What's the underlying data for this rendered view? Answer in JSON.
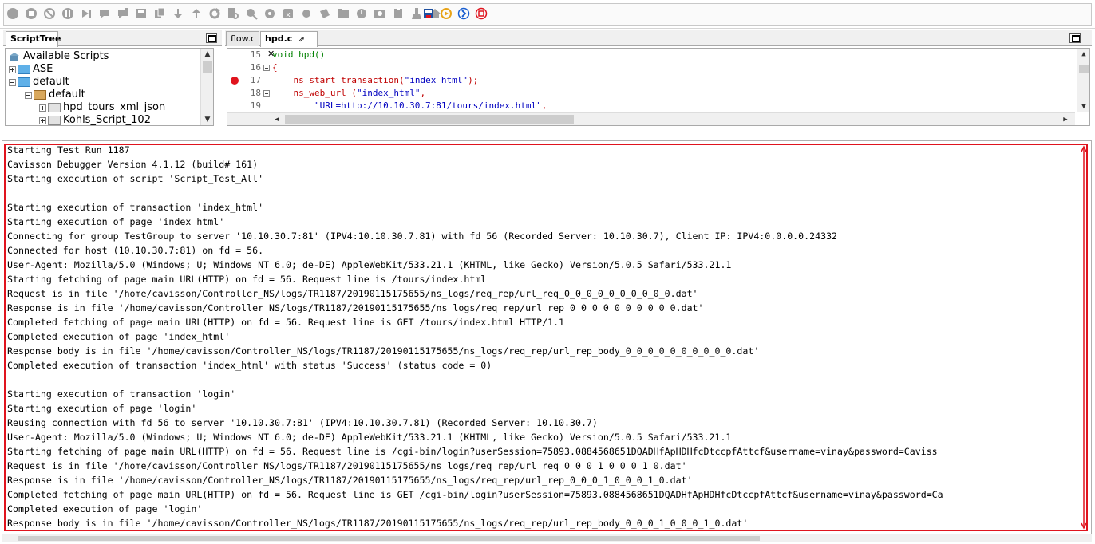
{
  "toolbar": {
    "buttons": [
      {
        "name": "start-icon",
        "color": "#a0a0a0"
      },
      {
        "name": "stop-icon",
        "color": "#a0a0a0"
      },
      {
        "name": "abort-icon",
        "color": "#a0a0a0"
      },
      {
        "name": "pause-icon",
        "color": "#a0a0a0"
      },
      {
        "name": "step-icon",
        "color": "#a0a0a0"
      },
      {
        "name": "comment-icon",
        "color": "#a0a0a0"
      },
      {
        "name": "comment-block-icon",
        "color": "#a0a0a0"
      },
      {
        "name": "save-icon",
        "color": "#a0a0a0"
      },
      {
        "name": "copy-icon",
        "color": "#a0a0a0"
      },
      {
        "name": "move-down-icon",
        "color": "#a0a0a0"
      },
      {
        "name": "move-up-icon",
        "color": "#a0a0a0"
      },
      {
        "name": "refresh-icon",
        "color": "#a0a0a0"
      },
      {
        "name": "search-document-icon",
        "color": "#a0a0a0"
      },
      {
        "name": "find-icon",
        "color": "#a0a0a0"
      },
      {
        "name": "settings-icon",
        "color": "#a0a0a0"
      },
      {
        "name": "variables-icon",
        "color": "#a0a0a0"
      },
      {
        "name": "record-icon",
        "color": "#a0a0a0"
      },
      {
        "name": "tag-icon",
        "color": "#a0a0a0"
      },
      {
        "name": "folder-icon",
        "color": "#a0a0a0"
      },
      {
        "name": "timer-icon",
        "color": "#a0a0a0"
      },
      {
        "name": "image-icon",
        "color": "#a0a0a0"
      },
      {
        "name": "paste-icon",
        "color": "#a0a0a0"
      },
      {
        "name": "clean-icon",
        "color": "#a0a0a0"
      },
      {
        "name": "home-icon",
        "color": "#a0a0a0"
      },
      {
        "name": "save-as-icon",
        "color": "#1d4fa0"
      },
      {
        "name": "replay-icon",
        "color": "#e8a317"
      },
      {
        "name": "step-over-icon",
        "color": "#1a5fd1"
      },
      {
        "name": "terminate-icon",
        "color": "#e0141e"
      }
    ]
  },
  "script_tree": {
    "tab_label": "ScriptTree",
    "items": [
      {
        "label": "Available Scripts",
        "level": 0,
        "folder": "root",
        "expander": "none"
      },
      {
        "label": "ASE",
        "level": 1,
        "folder": "blue",
        "expander": "plus"
      },
      {
        "label": "default",
        "level": 1,
        "folder": "blue",
        "expander": "minus"
      },
      {
        "label": "default",
        "level": 2,
        "folder": "tan",
        "expander": "minus"
      },
      {
        "label": "hpd_tours_xml_json",
        "level": 3,
        "folder": "gray",
        "expander": "plus"
      },
      {
        "label": "Kohls_Script_102",
        "level": 3,
        "folder": "gray",
        "expander": "plus"
      }
    ]
  },
  "editor": {
    "tabs": [
      {
        "label": "flow.c",
        "active": false
      },
      {
        "label": "hpd.c",
        "active": true
      }
    ],
    "lines": [
      {
        "number": "15",
        "fold": false,
        "breakpoint": false,
        "parts": [
          {
            "t": "void hpd()",
            "c": "kw"
          }
        ]
      },
      {
        "number": "16",
        "fold": true,
        "breakpoint": false,
        "parts": [
          {
            "t": "{",
            "c": "fn"
          }
        ]
      },
      {
        "number": "17",
        "fold": false,
        "breakpoint": true,
        "parts": [
          {
            "t": "    ns_start_transaction(",
            "c": "fn"
          },
          {
            "t": "\"index_html\"",
            "c": "str"
          },
          {
            "t": ");",
            "c": "fn"
          }
        ]
      },
      {
        "number": "18",
        "fold": true,
        "breakpoint": false,
        "parts": [
          {
            "t": "    ns_web_url (",
            "c": "fn"
          },
          {
            "t": "\"index_html\"",
            "c": "str"
          },
          {
            "t": ",",
            "c": "fn"
          }
        ]
      },
      {
        "number": "19",
        "fold": false,
        "breakpoint": false,
        "parts": [
          {
            "t": "        \"URL=http://10.10.30.7:81/tours/index.html\"",
            "c": "str"
          },
          {
            "t": ",",
            "c": "fn"
          }
        ]
      }
    ]
  },
  "console": {
    "lines": [
      "Starting Test Run 1187",
      "Cavisson Debugger Version 4.1.12 (build# 161)",
      "Starting execution of script 'Script_Test_All'",
      "",
      "Starting execution of transaction 'index_html'",
      "Starting execution of page 'index_html'",
      "Connecting for group TestGroup to server '10.10.30.7:81' (IPV4:10.10.30.7.81) with fd 56 (Recorded Server: 10.10.30.7), Client IP: IPV4:0.0.0.0.24332",
      "Connected for host (10.10.30.7:81) on fd = 56.",
      "User-Agent: Mozilla/5.0 (Windows; U; Windows NT 6.0; de-DE) AppleWebKit/533.21.1 (KHTML, like Gecko) Version/5.0.5 Safari/533.21.1",
      "Starting fetching of page main URL(HTTP) on fd = 56. Request line is /tours/index.html",
      "Request is in file '/home/cavisson/Controller_NS/logs/TR1187/20190115175655/ns_logs/req_rep/url_req_0_0_0_0_0_0_0_0_0_0.dat'",
      "Response is in file '/home/cavisson/Controller_NS/logs/TR1187/20190115175655/ns_logs/req_rep/url_rep_0_0_0_0_0_0_0_0_0_0.dat'",
      "Completed fetching of page main URL(HTTP) on fd = 56. Request line is GET /tours/index.html HTTP/1.1",
      "Completed execution of page 'index_html'",
      "Response body is in file '/home/cavisson/Controller_NS/logs/TR1187/20190115175655/ns_logs/req_rep/url_rep_body_0_0_0_0_0_0_0_0_0_0.dat'",
      "Completed execution of transaction 'index_html' with status 'Success' (status code = 0)",
      "",
      "Starting execution of transaction 'login'",
      "Starting execution of page 'login'",
      "Reusing connection with fd 56 to server '10.10.30.7:81' (IPV4:10.10.30.7.81) (Recorded Server: 10.10.30.7)",
      "User-Agent: Mozilla/5.0 (Windows; U; Windows NT 6.0; de-DE) AppleWebKit/533.21.1 (KHTML, like Gecko) Version/5.0.5 Safari/533.21.1",
      "Starting fetching of page main URL(HTTP) on fd = 56. Request line is /cgi-bin/login?userSession=75893.0884568651DQADHfApHDHfcDtccpfAttcf&username=vinay&password=Caviss",
      "Request is in file '/home/cavisson/Controller_NS/logs/TR1187/20190115175655/ns_logs/req_rep/url_req_0_0_0_1_0_0_0_1_0.dat'",
      "Response is in file '/home/cavisson/Controller_NS/logs/TR1187/20190115175655/ns_logs/req_rep/url_rep_0_0_0_1_0_0_0_1_0.dat'",
      "Completed fetching of page main URL(HTTP) on fd = 56. Request line is GET /cgi-bin/login?userSession=75893.0884568651DQADHfApHDHfcDtccpfAttcf&username=vinay&password=Ca",
      "Completed execution of page 'login'",
      "Response body is in file '/home/cavisson/Controller_NS/logs/TR1187/20190115175655/ns_logs/req_rep/url_rep_body_0_0_0_1_0_0_0_1_0.dat'"
    ]
  }
}
